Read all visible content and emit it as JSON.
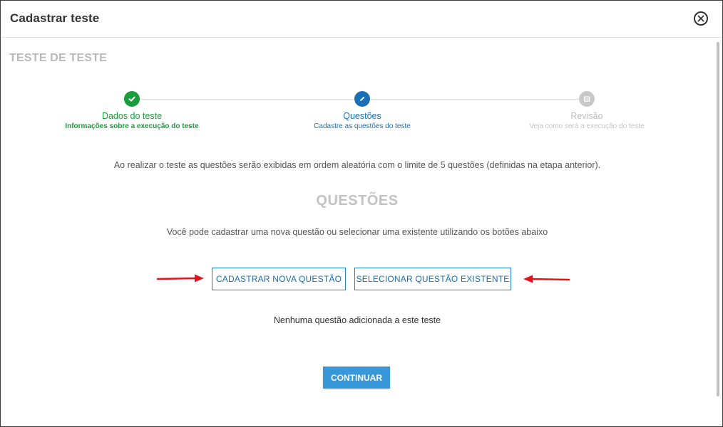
{
  "modal": {
    "title": "Cadastrar teste",
    "close_icon": "close-circle-icon"
  },
  "test_name": "TESTE DE TESTE",
  "stepper": {
    "steps": [
      {
        "title": "Dados do teste",
        "subtitle": "Informações sobre a execução do teste",
        "state": "completed",
        "icon": "check-icon",
        "color": "#1a9b3c"
      },
      {
        "title": "Questões",
        "subtitle": "Cadastre as questões do teste",
        "state": "active",
        "icon": "pencil-icon",
        "color": "#1b6fb5"
      },
      {
        "title": "Revisão",
        "subtitle": "Veja como será a execução do teste",
        "state": "pending",
        "icon": "review-icon",
        "color": "#c4c4c4"
      }
    ]
  },
  "info_text": "Ao realizar o teste as questões serão exibidas em ordem aleatória com o limite de 5 questões (definidas na etapa anterior).",
  "section_title": "QUESTÕES",
  "hint_text": "Você pode cadastrar uma nova questão ou selecionar uma existente utilizando os botões abaixo",
  "buttons": {
    "new_question": "CADASTRAR NOVA QUESTÃO",
    "select_question": "SELECIONAR QUESTÃO EXISTENTE",
    "continue": "CONTINUAR"
  },
  "empty_text": "Nenhuma questão adicionada a este teste",
  "colors": {
    "accent": "#1e7fc4",
    "success": "#1a9b3c",
    "annotation_arrow": "#e3141d",
    "primary_button": "#3897d8"
  }
}
